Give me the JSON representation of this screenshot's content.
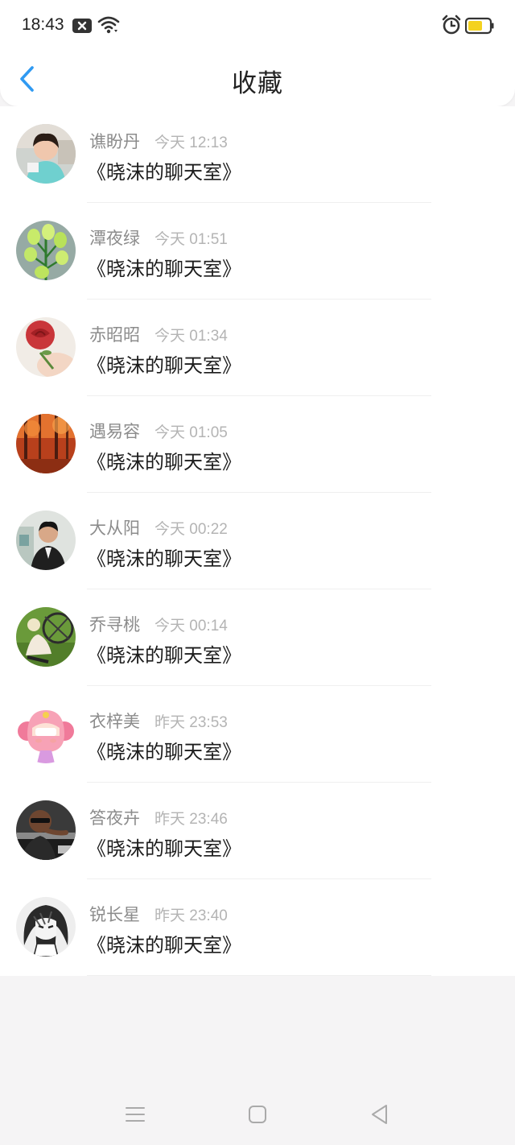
{
  "status_bar": {
    "time": "18:43",
    "icons": [
      "notification-x-icon",
      "wifi-icon",
      "alarm-icon",
      "battery-icon"
    ],
    "battery_color": "#f4d21f"
  },
  "header": {
    "title": "收藏",
    "back_icon": "chevron-left-icon",
    "accent_color": "#2f9af2"
  },
  "items": [
    {
      "name": "谯盼丹",
      "time": "今天 12:13",
      "message": "《晓沫的聊天室》"
    },
    {
      "name": "潭夜绿",
      "time": "今天 01:51",
      "message": "《晓沫的聊天室》"
    },
    {
      "name": "赤昭昭",
      "time": "今天 01:34",
      "message": "《晓沫的聊天室》"
    },
    {
      "name": "遇易容",
      "time": "今天 01:05",
      "message": "《晓沫的聊天室》"
    },
    {
      "name": "大从阳",
      "time": "今天 00:22",
      "message": "《晓沫的聊天室》"
    },
    {
      "name": "乔寻桃",
      "time": "今天 00:14",
      "message": "《晓沫的聊天室》"
    },
    {
      "name": "衣梓美",
      "time": "昨天 23:53",
      "message": "《晓沫的聊天室》"
    },
    {
      "name": "答夜卉",
      "time": "昨天 23:46",
      "message": "《晓沫的聊天室》"
    },
    {
      "name": "锐长星",
      "time": "昨天 23:40",
      "message": "《晓沫的聊天室》"
    }
  ],
  "nav_bar": {
    "icons": [
      "menu-icon",
      "home-square-icon",
      "back-triangle-icon"
    ]
  }
}
